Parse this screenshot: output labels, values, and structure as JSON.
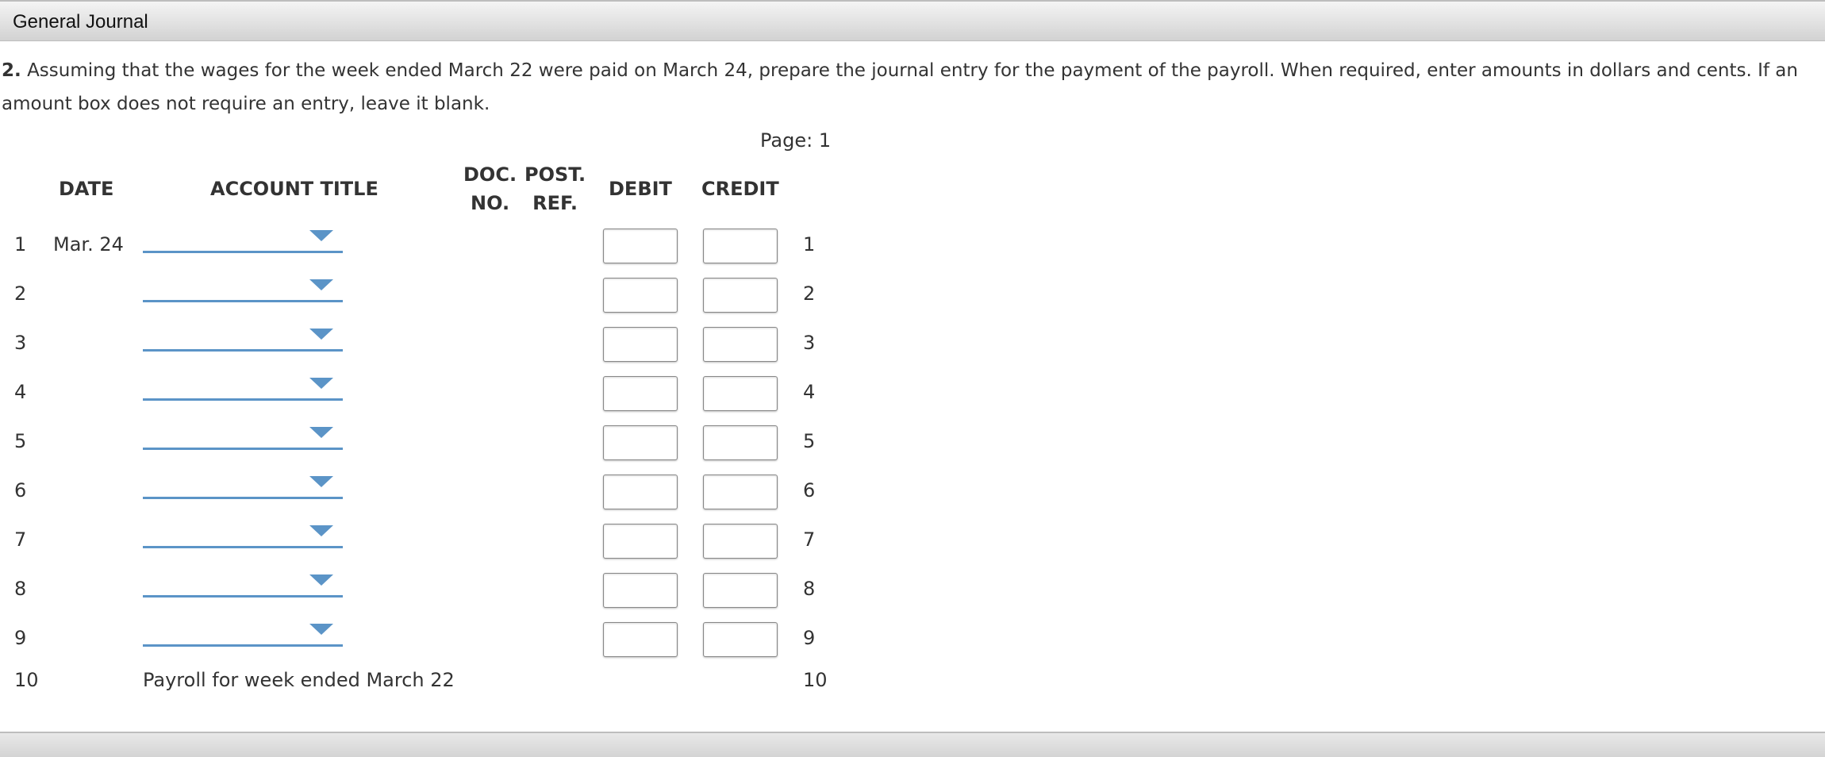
{
  "header": {
    "title": "General Journal"
  },
  "instructions": {
    "number": "2.",
    "text": "Assuming that the wages for the week ended March 22 were paid on March 24, prepare the journal entry for the payment of the payroll. When required, enter amounts in dollars and cents. If an amount box does not require an entry, leave it blank."
  },
  "page_label": "Page: 1",
  "columns": {
    "date": "DATE",
    "account_title": "ACCOUNT TITLE",
    "doc_no_1": "DOC.",
    "doc_no_2": "NO.",
    "post_ref_1": "POST.",
    "post_ref_2": "REF.",
    "debit": "DEBIT",
    "credit": "CREDIT"
  },
  "rows": [
    {
      "num": "1",
      "date": "Mar. 24",
      "account": "",
      "debit": "",
      "credit": ""
    },
    {
      "num": "2",
      "date": "",
      "account": "",
      "debit": "",
      "credit": ""
    },
    {
      "num": "3",
      "date": "",
      "account": "",
      "debit": "",
      "credit": ""
    },
    {
      "num": "4",
      "date": "",
      "account": "",
      "debit": "",
      "credit": ""
    },
    {
      "num": "5",
      "date": "",
      "account": "",
      "debit": "",
      "credit": ""
    },
    {
      "num": "6",
      "date": "",
      "account": "",
      "debit": "",
      "credit": ""
    },
    {
      "num": "7",
      "date": "",
      "account": "",
      "debit": "",
      "credit": ""
    },
    {
      "num": "8",
      "date": "",
      "account": "",
      "debit": "",
      "credit": ""
    },
    {
      "num": "9",
      "date": "",
      "account": "",
      "debit": "",
      "credit": ""
    }
  ],
  "explanation_row": {
    "num": "10",
    "text": "Payroll for week ended March 22"
  },
  "colors": {
    "dropdown_accent": "#5b94c7"
  },
  "icons": {
    "dropdown": "triangle-down-icon"
  }
}
